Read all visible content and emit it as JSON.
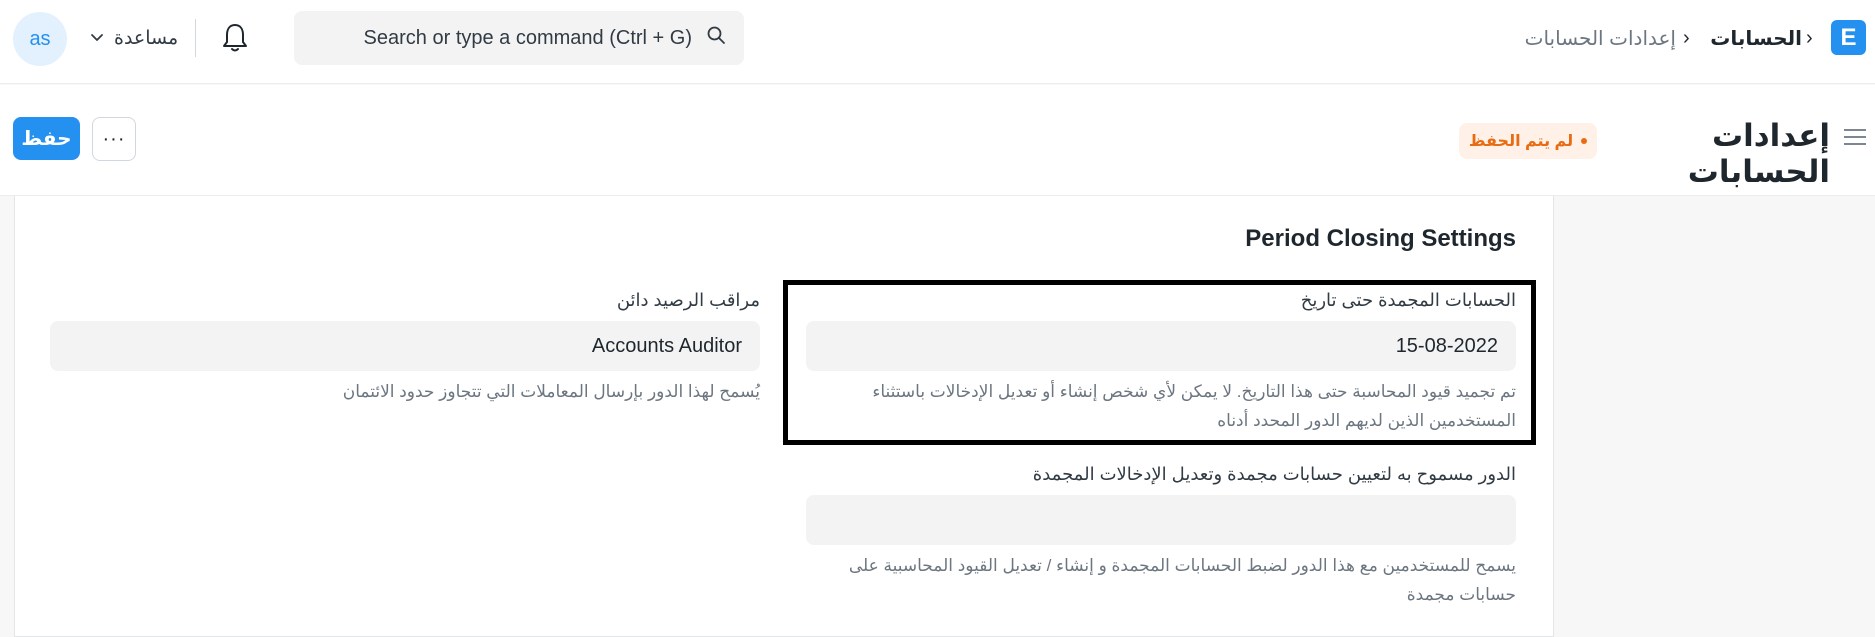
{
  "navbar": {
    "logo_letter": "E",
    "breadcrumb": [
      "الحسابات",
      "إعدادات الحسابات"
    ],
    "search_placeholder": "Search or type a command (Ctrl + G)",
    "help_label": "مساعدة",
    "avatar_initials": "as"
  },
  "page": {
    "title": "إعدادات الحسابات",
    "status_badge": "لم يتم الحفظ",
    "more_label": "···",
    "save_label": "حفظ"
  },
  "section": {
    "title": "Period Closing Settings",
    "fields": {
      "frozen_till": {
        "label": "الحسابات المجمدة حتى تاريخ",
        "value": "15-08-2022",
        "description": "تم تجميد قيود المحاسبة حتى هذا التاريخ. لا يمكن لأي شخص إنشاء أو تعديل الإدخالات باستثناء المستخدمين الذين لديهم الدور المحدد أدناه"
      },
      "frozen_role": {
        "label": "الدور مسموح به لتعيين حسابات مجمدة وتعديل الإدخالات المجمدة",
        "value": "",
        "description": "يسمح للمستخدمين مع هذا الدور لضبط الحسابات المجمدة و إنشاء / تعديل القيود المحاسبية على حسابات مجمدة"
      },
      "credit_controller": {
        "label": "مراقب الرصيد دائن",
        "value": "Accounts Auditor",
        "description": "يُسمح لهذا الدور بإرسال المعاملات التي تتجاوز حدود الائتمان"
      }
    }
  },
  "icons": {
    "logo": "app-logo-icon",
    "search": "search-icon",
    "bell": "bell-icon",
    "chevron": "chevron-down-icon",
    "menu": "hamburger-menu-icon"
  },
  "colors": {
    "primary": "#2490ef",
    "warning": "#e86c13",
    "warning_bg": "#fff1e7"
  }
}
